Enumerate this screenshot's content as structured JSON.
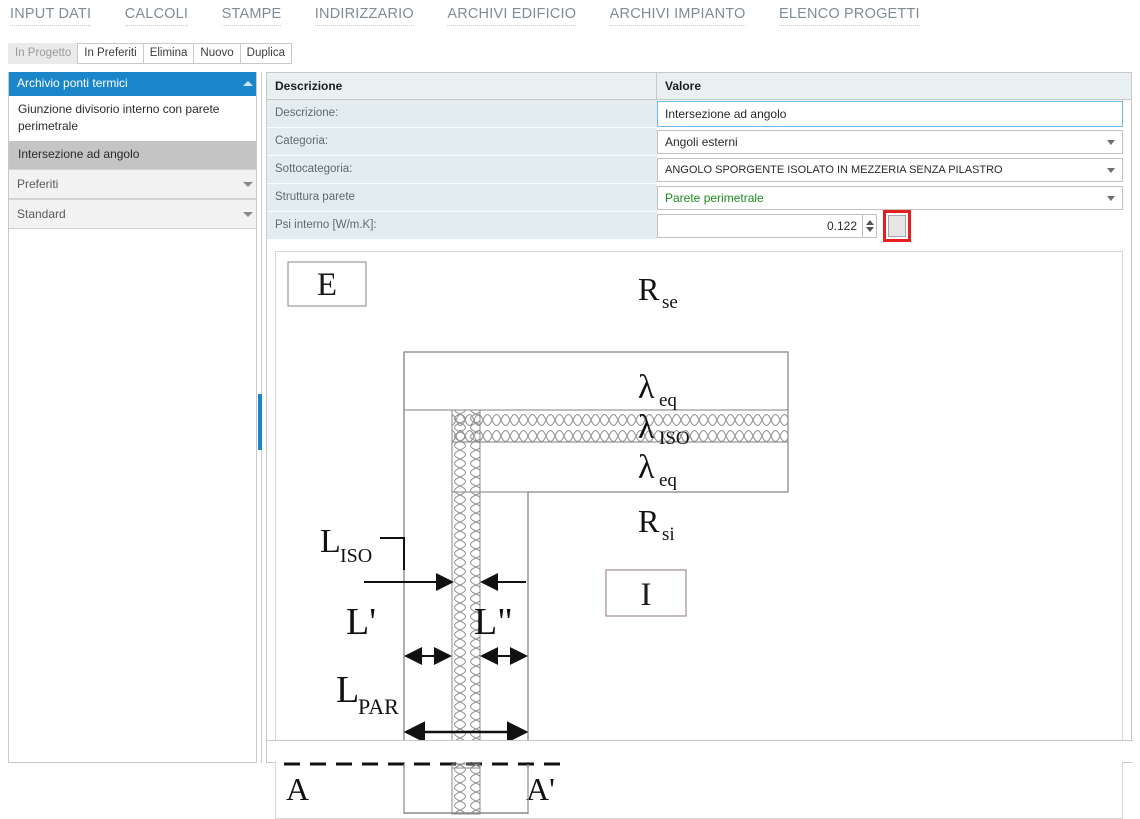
{
  "nav": {
    "items": [
      {
        "label": "INPUT DATI"
      },
      {
        "label": "CALCOLI"
      },
      {
        "label": "STAMPE"
      },
      {
        "label": "INDIRIZZARIO"
      },
      {
        "label": "ARCHIVI EDIFICIO"
      },
      {
        "label": "ARCHIVI IMPIANTO"
      },
      {
        "label": "ELENCO PROGETTI"
      }
    ]
  },
  "toolbar": {
    "buttons": [
      {
        "label": "In Progetto",
        "disabled": true
      },
      {
        "label": "In Preferiti",
        "disabled": false
      },
      {
        "label": "Elimina",
        "disabled": false
      },
      {
        "label": "Nuovo",
        "disabled": false
      },
      {
        "label": "Duplica",
        "disabled": false
      }
    ]
  },
  "sidebar": {
    "sections": [
      {
        "title": "Archivio ponti termici",
        "state": "expanded",
        "items": [
          {
            "label": "Giunzione divisorio interno con parete perimetrale",
            "selected": false
          },
          {
            "label": "Intersezione ad angolo",
            "selected": true
          }
        ]
      },
      {
        "title": "Preferiti",
        "state": "collapsed",
        "items": []
      },
      {
        "title": "Standard",
        "state": "collapsed",
        "items": []
      }
    ]
  },
  "grid": {
    "headers": {
      "description": "Descrizione",
      "value": "Valore"
    },
    "rows": [
      {
        "label": "Descrizione:",
        "value": "Intersezione ad angolo",
        "type": "text"
      },
      {
        "label": "Categoria:",
        "value": "Angoli esterni",
        "type": "select"
      },
      {
        "label": "Sottocategoria:",
        "value": "ANGOLO SPORGENTE ISOLATO IN MEZZERIA SENZA PILASTRO",
        "type": "select"
      },
      {
        "label": "Struttura parete",
        "value": "Parete perimetrale",
        "type": "select-green"
      },
      {
        "label": "Psi interno [W/m.K]:",
        "value": "0.122",
        "type": "spinner"
      }
    ]
  },
  "diagram": {
    "labels": {
      "exterior": "E",
      "interior": "I",
      "r_se": "R",
      "r_se_sub": "se",
      "r_si": "R",
      "r_si_sub": "si",
      "lambda": "λ",
      "lambda_eq_sub": "eq",
      "lambda_iso_sub": "ISO",
      "l_iso": "L",
      "l_iso_sub": "ISO",
      "l_prime": "L'",
      "l_double_prime": "L\"",
      "l_par": "L",
      "l_par_sub": "PAR",
      "section_a": "A",
      "section_a_prime": "A'"
    }
  },
  "colors": {
    "accent": "#1b86c9",
    "highlight": "#e51e1e",
    "header_bg": "#e9f0f2",
    "label_bg": "#e3ecee",
    "green_text": "#1f8b1f",
    "nav_text": "#7f8c95",
    "selected_item_bg": "#c4c4c4"
  }
}
